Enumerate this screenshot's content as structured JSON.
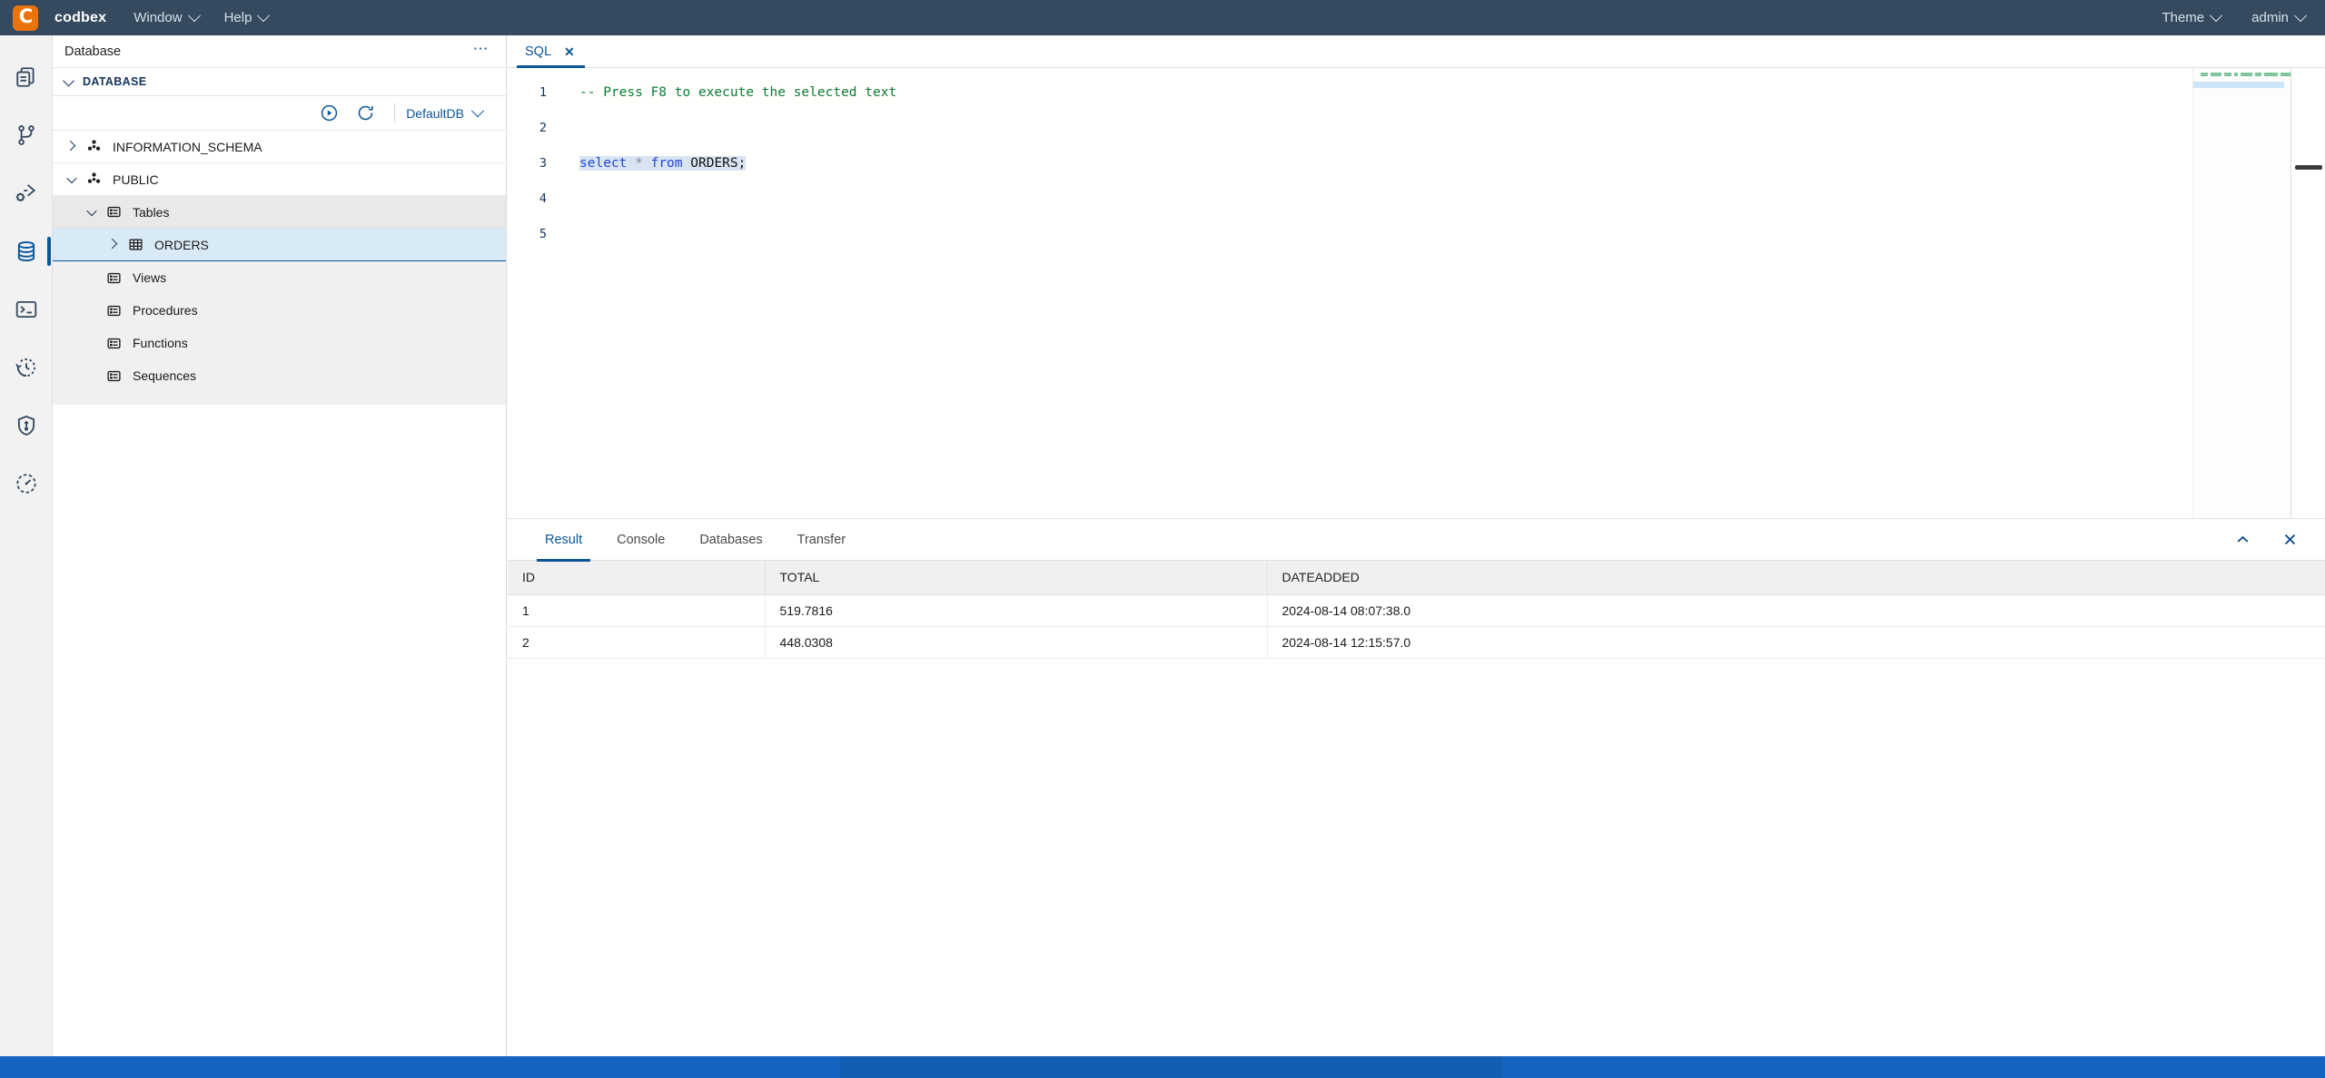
{
  "topbar": {
    "brand": "codbex",
    "logo_letter": "C",
    "logo_color": "#e9730c",
    "background": "#354a5f",
    "menus": [
      {
        "label": "Window",
        "icon": "chevron-down-icon"
      },
      {
        "label": "Help",
        "icon": "chevron-down-icon"
      }
    ],
    "right_menus": [
      {
        "label": "Theme",
        "icon": "chevron-down-icon"
      },
      {
        "label": "admin",
        "icon": "chevron-down-icon"
      }
    ]
  },
  "activity_bar": {
    "accent": "#0a5699",
    "items": [
      {
        "name": "files-icon",
        "label": "Files",
        "active": false
      },
      {
        "name": "git-branch-icon",
        "label": "Git",
        "active": false
      },
      {
        "name": "debug-run-icon",
        "label": "Debug",
        "active": false
      },
      {
        "name": "database-icon",
        "label": "Database",
        "active": true
      },
      {
        "name": "terminal-icon",
        "label": "Terminal",
        "active": false
      },
      {
        "name": "history-clock-icon",
        "label": "History",
        "active": false
      },
      {
        "name": "shield-lock-icon",
        "label": "Security",
        "active": false
      },
      {
        "name": "gauge-icon",
        "label": "Monitoring",
        "active": false
      }
    ]
  },
  "sidebar": {
    "title": "Database",
    "more_icon": "ellipsis-icon",
    "section": {
      "label": "DATABASE",
      "expanded": true
    },
    "toolbar": {
      "run_icon": "play-circle-icon",
      "refresh_icon": "refresh-icon",
      "datasource": "DefaultDB",
      "datasource_caret": "chevron-down-icon"
    },
    "tree": [
      {
        "label": "INFORMATION_SCHEMA",
        "level": 0,
        "icon": "schema-icon",
        "twisty": "collapsed",
        "state": "normal"
      },
      {
        "label": "PUBLIC",
        "level": 0,
        "icon": "schema-icon",
        "twisty": "expanded",
        "state": "normal"
      },
      {
        "label": "Tables",
        "level": 1,
        "icon": "folder-list-icon",
        "twisty": "expanded",
        "state": "shaded"
      },
      {
        "label": "ORDERS",
        "level": 2,
        "icon": "table-grid-icon",
        "twisty": "collapsed",
        "state": "selected"
      },
      {
        "label": "Views",
        "level": 1,
        "icon": "folder-list-icon",
        "twisty": "none",
        "state": "plain"
      },
      {
        "label": "Procedures",
        "level": 1,
        "icon": "folder-list-icon",
        "twisty": "none",
        "state": "plain"
      },
      {
        "label": "Functions",
        "level": 1,
        "icon": "folder-list-icon",
        "twisty": "none",
        "state": "plain"
      },
      {
        "label": "Sequences",
        "level": 1,
        "icon": "folder-list-icon",
        "twisty": "none",
        "state": "plain"
      }
    ]
  },
  "editor": {
    "tabs": [
      {
        "label": "SQL",
        "close_icon": "close-icon",
        "active": true
      }
    ],
    "lines": [
      {
        "number": "1",
        "type": "comment",
        "text": "-- Press F8 to execute the selected text"
      },
      {
        "number": "2",
        "type": "blank",
        "text": ""
      },
      {
        "number": "3",
        "type": "sql",
        "text": "select * from ORDERS;"
      },
      {
        "number": "4",
        "type": "blank",
        "text": ""
      },
      {
        "number": "5",
        "type": "blank",
        "text": ""
      }
    ],
    "sql_tokens": {
      "kw_select": "select",
      "star": "*",
      "kw_from": "from",
      "table": "ORDERS;"
    }
  },
  "result_panel": {
    "tabs": [
      {
        "label": "Result",
        "active": true
      },
      {
        "label": "Console",
        "active": false
      },
      {
        "label": "Databases",
        "active": false
      },
      {
        "label": "Transfer",
        "active": false
      }
    ],
    "collapse_icon": "chevron-up-icon",
    "close_icon": "close-icon",
    "grid": {
      "columns": [
        "ID",
        "TOTAL",
        "DATEADDED"
      ],
      "rows": [
        [
          "1",
          "519.7816",
          "2024-08-14 08:07:38.0"
        ],
        [
          "2",
          "448.0308",
          "2024-08-14 12:15:57.0"
        ]
      ]
    }
  },
  "statusbar": {
    "background": "#1565c0"
  }
}
